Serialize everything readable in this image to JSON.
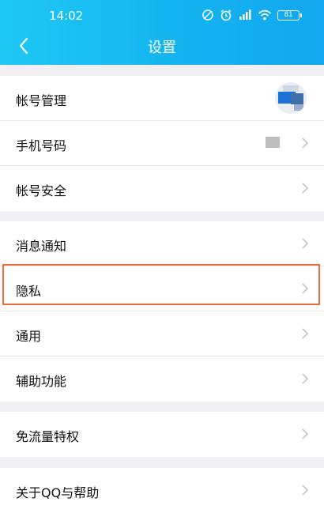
{
  "status_bar": {
    "time": "14:02",
    "battery": "81"
  },
  "nav": {
    "title": "设置"
  },
  "groups": [
    {
      "items": [
        {
          "label": "帐号管理"
        },
        {
          "label": "手机号码"
        },
        {
          "label": "帐号安全"
        }
      ]
    },
    {
      "items": [
        {
          "label": "消息通知"
        },
        {
          "label": "隐私"
        },
        {
          "label": "通用"
        },
        {
          "label": "辅助功能"
        }
      ]
    },
    {
      "items": [
        {
          "label": "免流量特权"
        }
      ]
    },
    {
      "items": [
        {
          "label": "关于QQ与帮助"
        }
      ]
    }
  ],
  "colors": {
    "header_gradient_start": "#1ec8f4",
    "header_gradient_end": "#12a7ee",
    "highlight_border": "#f26b3a",
    "page_background": "#efeff4"
  }
}
